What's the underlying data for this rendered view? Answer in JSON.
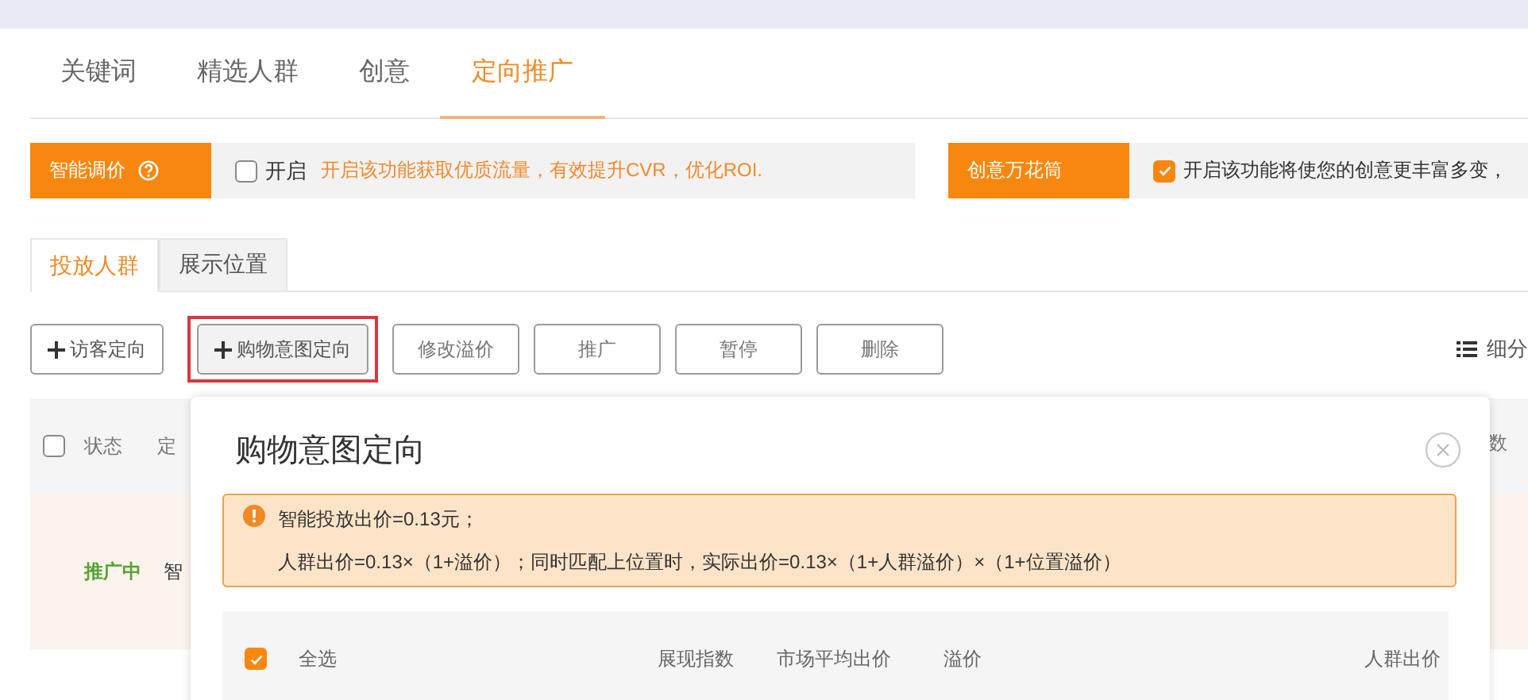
{
  "top_tabs": [
    {
      "label": "关键词",
      "selected": false
    },
    {
      "label": "精选人群",
      "selected": false
    },
    {
      "label": "创意",
      "selected": false
    },
    {
      "label": "定向推广",
      "selected": true
    }
  ],
  "features": [
    {
      "title": "智能调价",
      "checked": false,
      "checkbox_label": "开启",
      "description": "开启该功能获取优质流量，有效提升CVR，优化ROI.",
      "kind": "hint"
    },
    {
      "title": "创意万花筒",
      "checked": true,
      "description": "开启该功能将使您的创意更丰富多变，",
      "kind": "text"
    }
  ],
  "sub_tabs": [
    {
      "label": "投放人群",
      "selected": true
    },
    {
      "label": "展示位置",
      "selected": false
    }
  ],
  "toolbar": {
    "buttons": [
      {
        "label": "访客定向",
        "kind": "add",
        "highlighted": false
      },
      {
        "label": "购物意图定向",
        "kind": "add",
        "highlighted": true
      },
      {
        "label": "修改溢价",
        "kind": "plain",
        "highlighted": false
      },
      {
        "label": "推广",
        "kind": "plain",
        "highlighted": false
      },
      {
        "label": "暂停",
        "kind": "plain",
        "highlighted": false
      },
      {
        "label": "删除",
        "kind": "plain",
        "highlighted": false
      }
    ],
    "view_option": "细分"
  },
  "table": {
    "select_all_checked": false,
    "columns": [
      "状态",
      "定",
      "数"
    ],
    "rows": [
      {
        "status": "推广中",
        "name": "智"
      }
    ]
  },
  "modal": {
    "title": "购物意图定向",
    "notice": [
      "智能投放出价=0.13元；",
      "人群出价=0.13×（1+溢价）；同时匹配上位置时，实际出价=0.13×（1+人群溢价）×（1+位置溢价）"
    ],
    "select_all": {
      "label": "全选",
      "checked": true
    },
    "columns": [
      "展现指数",
      "市场平均出价",
      "溢价",
      "人群出价"
    ]
  }
}
